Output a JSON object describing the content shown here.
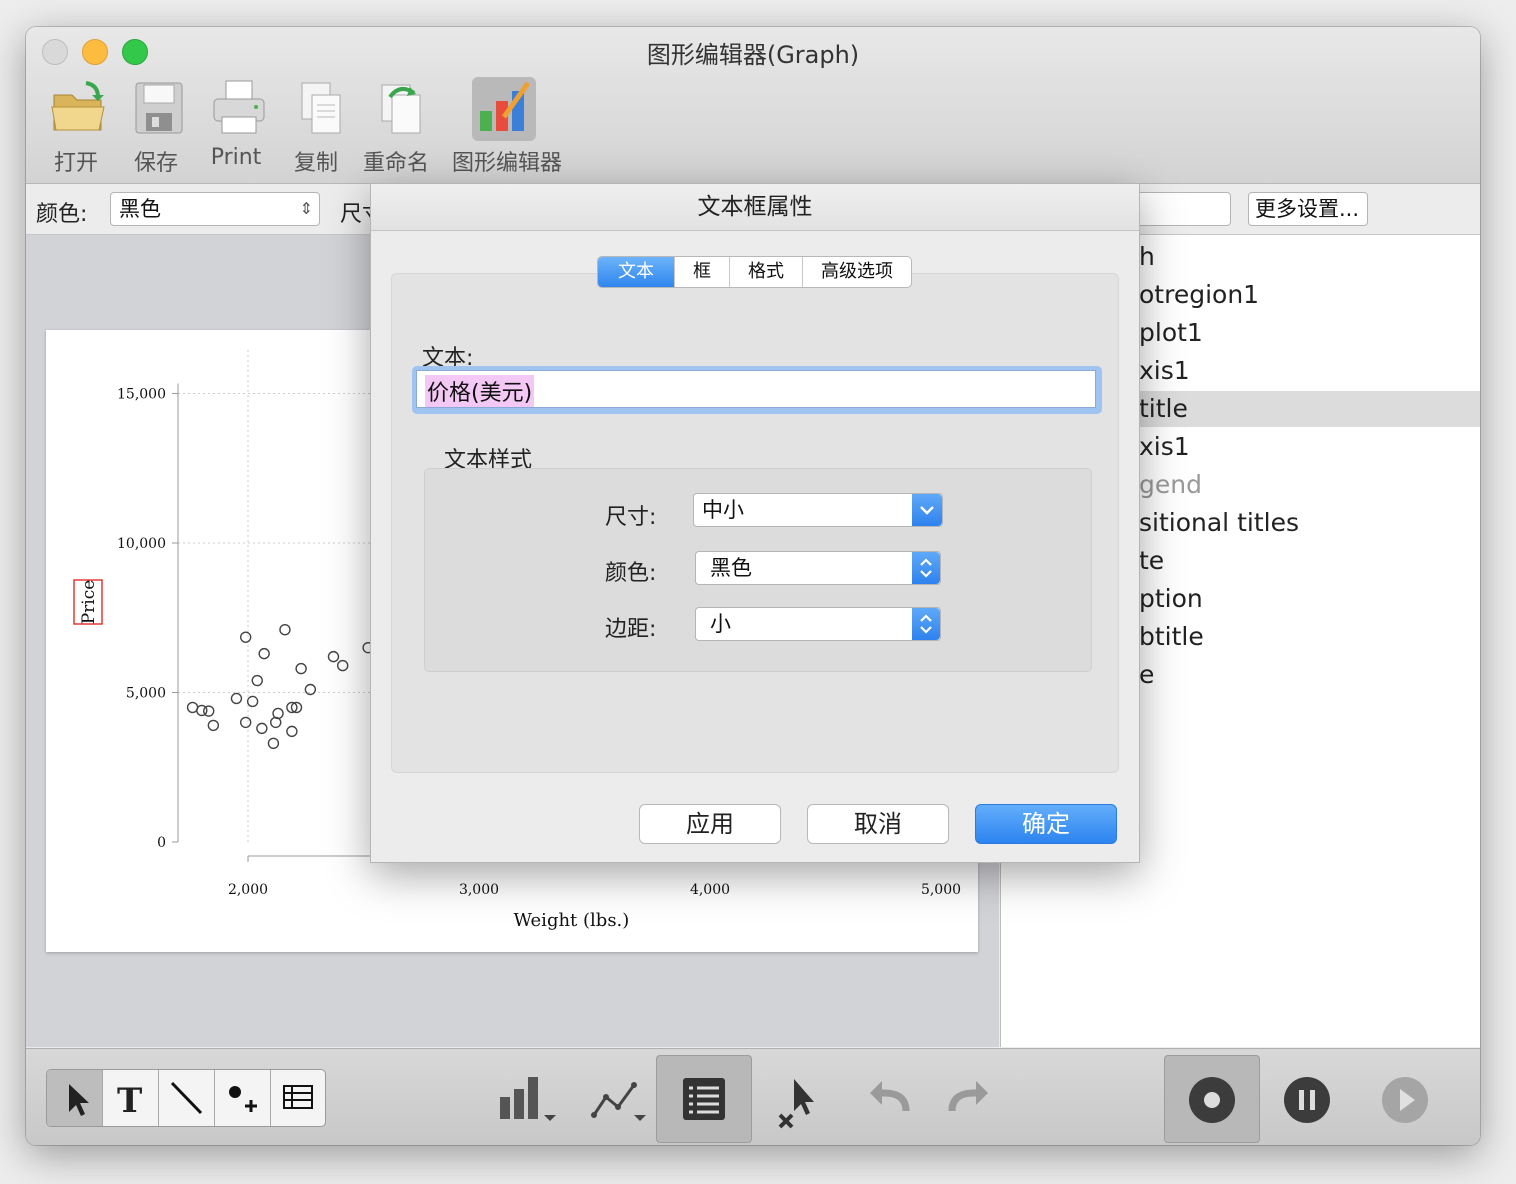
{
  "window": {
    "title": "图形编辑器(Graph)"
  },
  "toolbar": {
    "items": [
      {
        "label": "打开",
        "icon": "folder-open-icon"
      },
      {
        "label": "保存",
        "icon": "floppy-disk-icon"
      },
      {
        "label": "Print",
        "icon": "printer-icon"
      },
      {
        "label": "复制",
        "icon": "copy-documents-icon"
      },
      {
        "label": "重命名",
        "icon": "rename-document-icon"
      },
      {
        "label": "图形编辑器",
        "icon": "graph-editor-chart-icon"
      }
    ]
  },
  "propbar": {
    "color_label": "颜色:",
    "color_value": "黑色",
    "size_label": "尺寸",
    "more_settings": "更多设置..."
  },
  "tree": {
    "items": [
      "h",
      "otregion1",
      "plot1",
      "xis1",
      "title",
      "xis1",
      "gend",
      "sitional titles",
      "te",
      "ption",
      "btitle",
      "e"
    ],
    "selected_index": 4
  },
  "chart_data": {
    "type": "scatter",
    "xlabel": "Weight (lbs.)",
    "ylabel": "Price",
    "x_ticks": [
      "2,000",
      "3,000",
      "4,000",
      "5,000"
    ],
    "y_ticks": [
      "0",
      "5,000",
      "10,000",
      "15,000"
    ],
    "xlim": [
      1700,
      5000
    ],
    "ylim": [
      0,
      15000
    ],
    "points": [
      [
        1760,
        4500
      ],
      [
        1800,
        4400
      ],
      [
        1830,
        4380
      ],
      [
        1850,
        3900
      ],
      [
        1950,
        4800
      ],
      [
        1990,
        4000
      ],
      [
        1990,
        6850
      ],
      [
        2020,
        4700
      ],
      [
        2040,
        5400
      ],
      [
        2060,
        3800
      ],
      [
        2070,
        6300
      ],
      [
        2110,
        3300
      ],
      [
        2130,
        4300
      ],
      [
        2120,
        4000
      ],
      [
        2160,
        7100
      ],
      [
        2190,
        4500
      ],
      [
        2190,
        3700
      ],
      [
        2210,
        4500
      ],
      [
        2230,
        5800
      ],
      [
        2270,
        5100
      ],
      [
        2370,
        6200
      ],
      [
        2410,
        5900
      ],
      [
        2520,
        6500
      ]
    ]
  },
  "dialog": {
    "title": "文本框属性",
    "tabs": [
      "文本",
      "框",
      "格式",
      "高级选项"
    ],
    "active_tab": 0,
    "text_label": "文本:",
    "text_value": "价格(美元)",
    "style_group_label": "文本样式",
    "size_label": "尺寸:",
    "size_value": "中小",
    "color_label": "颜色:",
    "color_value": "黑色",
    "margin_label": "边距:",
    "margin_value": "小",
    "apply": "应用",
    "cancel": "取消",
    "ok": "确定"
  },
  "bottombar": {
    "tools": [
      "pointer-icon",
      "text-tool-icon",
      "line-tool-icon",
      "add-marker-icon",
      "table-grid-icon"
    ],
    "center_icons": [
      "bar-chart-icon",
      "line-chart-icon",
      "object-browser-list-icon",
      "grab-pointer-icon",
      "undo-icon",
      "redo-icon"
    ],
    "record_icons": [
      "record-icon",
      "pause-icon",
      "play-icon"
    ]
  },
  "colors": {
    "accent": "#2f86ee",
    "selected_row": "#dcdcdc",
    "highlight_text": "#f4c8f4"
  }
}
